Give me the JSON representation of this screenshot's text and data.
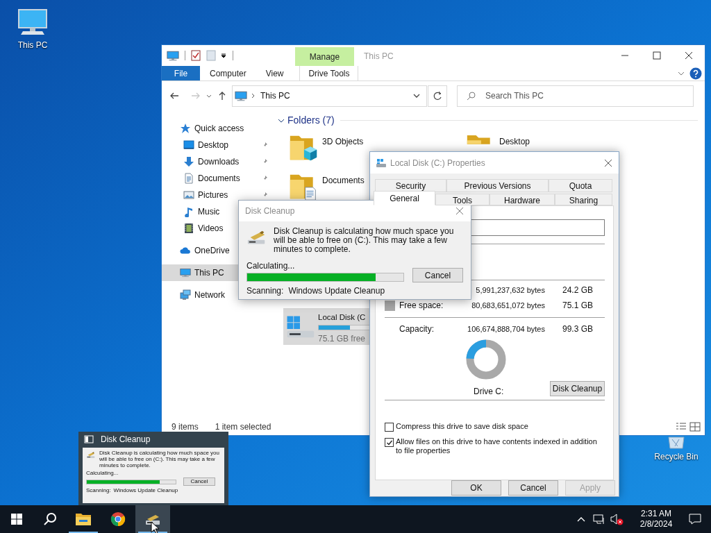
{
  "desktop_icons": [
    {
      "label": "This PC",
      "kind": "pc"
    },
    {
      "label": "Recycle Bin",
      "kind": "bin"
    }
  ],
  "explorer": {
    "title": "This PC",
    "context_group": "Manage",
    "ribbon_tabs": [
      {
        "label": "File",
        "kind": "file"
      },
      {
        "label": "Computer",
        "kind": "plain"
      },
      {
        "label": "View",
        "kind": "plain"
      },
      {
        "label": "Drive Tools",
        "kind": "context"
      }
    ],
    "address": "This PC",
    "search": {
      "placeholder": "Search This PC"
    },
    "nav": [
      {
        "label": "Quick access",
        "kind": "star",
        "selected": false,
        "children": [
          {
            "label": "Desktop",
            "kind": "desktop",
            "pinned": true
          },
          {
            "label": "Downloads",
            "kind": "download",
            "pinned": true
          },
          {
            "label": "Documents",
            "kind": "document",
            "pinned": true
          },
          {
            "label": "Pictures",
            "kind": "picture",
            "pinned": true
          },
          {
            "label": "Music",
            "kind": "music",
            "pinned": false
          },
          {
            "label": "Videos",
            "kind": "video",
            "pinned": false
          }
        ]
      },
      {
        "label": "OneDrive",
        "kind": "cloud",
        "selected": false
      },
      {
        "label": "This PC",
        "kind": "pc",
        "selected": true
      },
      {
        "label": "Network",
        "kind": "network",
        "selected": false
      }
    ],
    "group": "Folders (7)",
    "folders": [
      {
        "label": "3D Objects",
        "kind": "cube"
      },
      {
        "label": "Desktop",
        "kind": "desktop"
      },
      {
        "label": "Documents",
        "kind": "document"
      }
    ],
    "drive": {
      "label": "Local Disk (C",
      "free": "75.1 GB free",
      "level": 0.24,
      "selected": true
    },
    "status": [
      "9 items",
      "1 item selected"
    ]
  },
  "properties": {
    "title": "Local Disk (C:) Properties",
    "tabs_back": [
      {
        "label": "Security",
        "selected": false
      },
      {
        "label": "Previous Versions",
        "selected": false
      },
      {
        "label": "Quota",
        "selected": false
      }
    ],
    "tabs_front": [
      {
        "label": "General",
        "selected": true
      },
      {
        "label": "Tools",
        "selected": false
      },
      {
        "label": "Hardware",
        "selected": false
      },
      {
        "label": "Sharing",
        "selected": false
      }
    ],
    "space": [
      {
        "kind": "used",
        "bytes": "5,991,237,632 bytes",
        "size": "24.2 GB"
      },
      {
        "kind": "free",
        "label": "Free space:",
        "bytes": "80,683,651,072 bytes",
        "size": "75.1 GB"
      }
    ],
    "capacity": {
      "label": "Capacity:",
      "bytes": "106,674,888,704 bytes",
      "size": "99.3 GB"
    },
    "usage": {
      "level": 0.24
    },
    "drive_label": "Drive C:",
    "cleanup_button": "Disk Cleanup",
    "options": [
      {
        "label": "Compress this drive to save disk space",
        "checked": false
      },
      {
        "label": "Allow files on this drive to have contents indexed in addition to file properties",
        "checked": true
      }
    ],
    "buttons": [
      {
        "label": "OK",
        "disabled": false
      },
      {
        "label": "Cancel",
        "disabled": false
      },
      {
        "label": "Apply",
        "disabled": true
      }
    ]
  },
  "cleanup": {
    "title": "Disk Cleanup",
    "message": "Disk Cleanup is calculating how much space you will be able to free on  (C:). This may take a few minutes to complete.",
    "status": "Calculating...",
    "level": 0.82,
    "cancel": "Cancel",
    "scanning_label": "Scanning:",
    "scanning_item": "Windows Update Cleanup"
  },
  "thumbnail": {
    "title": "Disk Cleanup",
    "message": "Disk Cleanup is calculating how much space you will be able to free on  (C:). This may take a few minutes to complete.",
    "status": "Calculating...",
    "level": 0.82,
    "cancel": "Cancel",
    "scanning_label": "Scanning:",
    "scanning_item": "Windows Update Cleanup"
  },
  "taskbar": {
    "apps": [
      {
        "kind": "explorer",
        "running": true,
        "selected": false
      },
      {
        "kind": "browser",
        "running": false,
        "selected": false
      },
      {
        "kind": "cleanup",
        "running": true,
        "selected": true
      }
    ],
    "clock": {
      "time": "2:31 AM",
      "date": "2/8/2024"
    }
  }
}
